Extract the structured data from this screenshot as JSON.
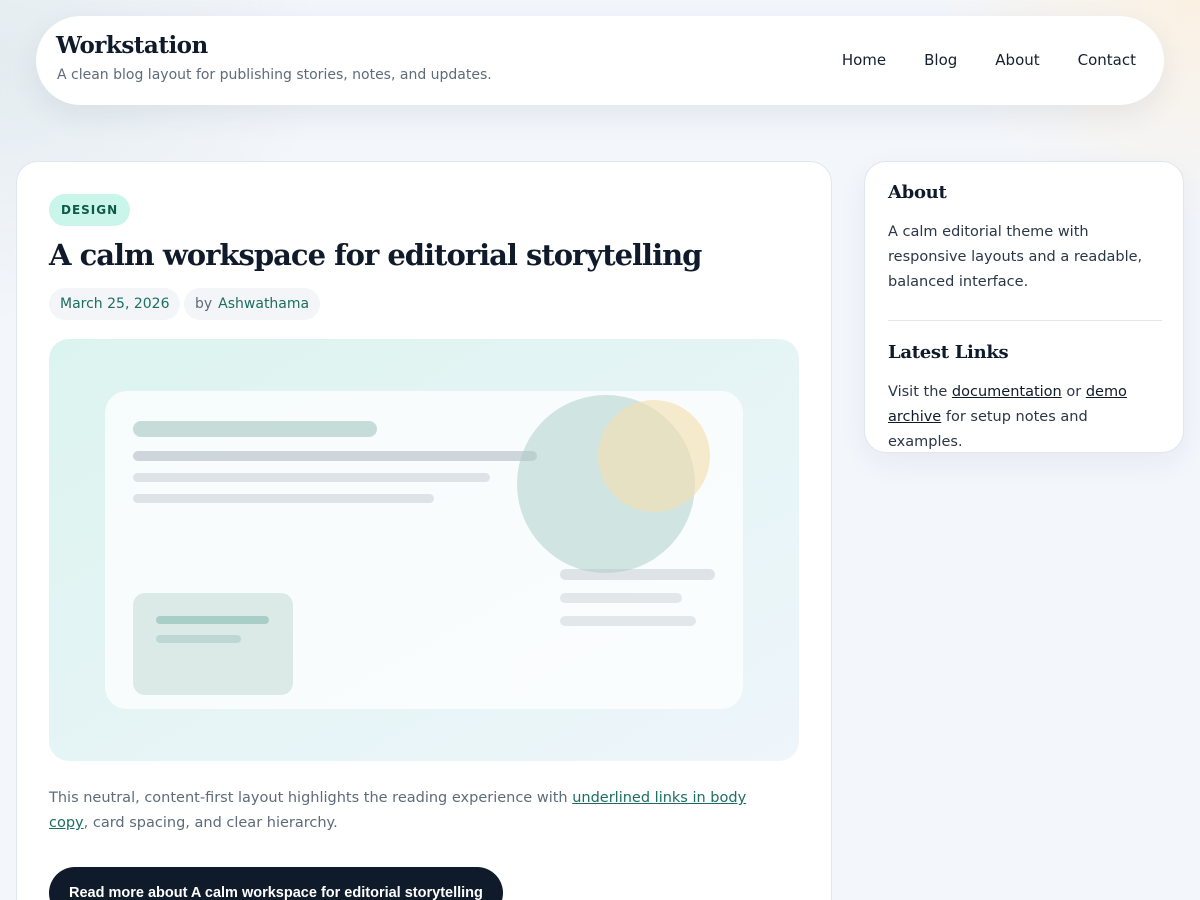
{
  "site": {
    "title": "Workstation",
    "tagline": "A clean blog layout for publishing stories, notes, and updates."
  },
  "nav": {
    "items": [
      "Home",
      "Blog",
      "About",
      "Contact"
    ]
  },
  "post": {
    "category": "DESIGN",
    "title": "A calm workspace for editorial storytelling",
    "date": "March 25, 2026",
    "by": "by",
    "author": "Ashwathama",
    "excerpt_before": "This neutral, content-first layout highlights the reading experience with ",
    "excerpt_link": "underlined links in body copy",
    "excerpt_after": ", card spacing, and clear hierarchy.",
    "read_more": "Read more about A calm workspace for editorial storytelling"
  },
  "sidebar": {
    "about_heading": "About",
    "about_text": "A calm editorial theme with responsive layouts and a readable, balanced interface.",
    "links_heading": "Latest Links",
    "links_text_1": "Visit the ",
    "links_link_1": "documentation",
    "links_text_2": " or ",
    "links_link_2": "demo archive",
    "links_text_3": " for setup notes and examples."
  },
  "colors": {
    "accent": "#1c6e63",
    "tag_bg": "#c9f5ea",
    "button_bg": "#0f1a2a",
    "hero_circle_teal": "#a8cbc6",
    "hero_circle_gold": "#f3dfb0"
  }
}
